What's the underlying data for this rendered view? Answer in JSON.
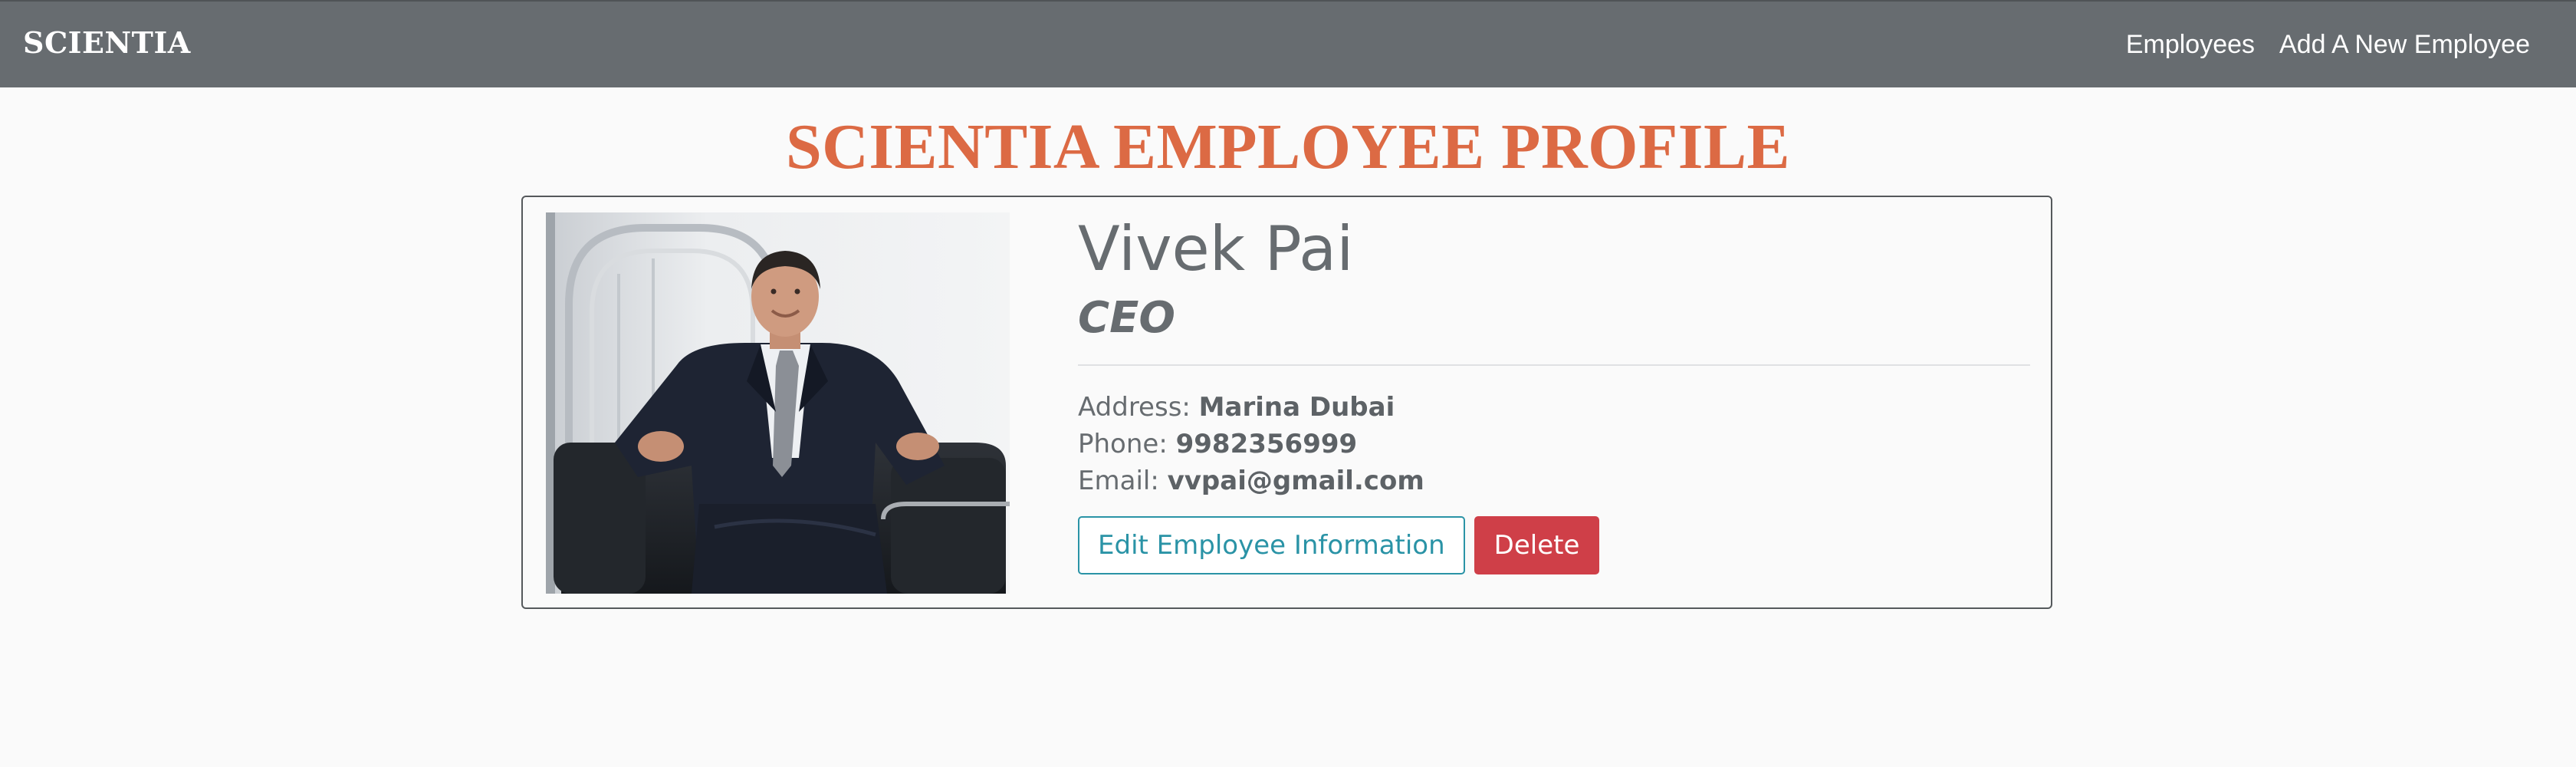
{
  "navbar": {
    "brand": "SCIENTIA",
    "links": [
      {
        "label": "Employees"
      },
      {
        "label": "Add A New Employee"
      }
    ],
    "background": "#676c70"
  },
  "page": {
    "title": "SCIENTIA EMPLOYEE PROFILE",
    "title_color": "#dc6a44"
  },
  "employee": {
    "name": "Vivek Pai",
    "title": "CEO",
    "address_label": "Address:",
    "address": "Marina Dubai",
    "phone_label": "Phone:",
    "phone": "9982356999",
    "email_label": "Email:",
    "email": "vvpai@gmail.com"
  },
  "actions": {
    "edit_label": "Edit Employee Information",
    "delete_label": "Delete",
    "edit_color": "#2a93a6",
    "delete_color": "#cf3f48"
  }
}
